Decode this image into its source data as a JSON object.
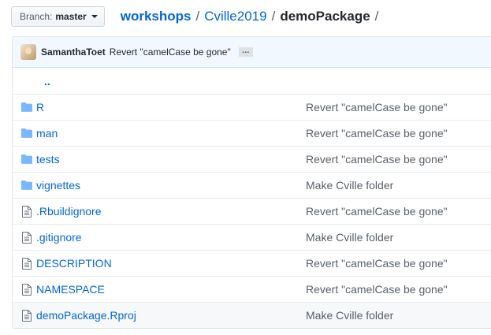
{
  "branch": {
    "prefix": "Branch:",
    "name": "master"
  },
  "breadcrumb": {
    "repo": "workshops",
    "folder": "Cville2019",
    "current": "demoPackage",
    "separator": "/"
  },
  "commit": {
    "author": "SamanthaToet",
    "message": "Revert \"camelCase be gone\"",
    "ellipsis": "…"
  },
  "updir": "..",
  "files": [
    {
      "name": "R",
      "type": "folder",
      "message": "Revert \"camelCase be gone\""
    },
    {
      "name": "man",
      "type": "folder",
      "message": "Revert \"camelCase be gone\""
    },
    {
      "name": "tests",
      "type": "folder",
      "message": "Revert \"camelCase be gone\""
    },
    {
      "name": "vignettes",
      "type": "folder",
      "message": "Make Cville folder"
    },
    {
      "name": ".Rbuildignore",
      "type": "file",
      "message": "Revert \"camelCase be gone\""
    },
    {
      "name": ".gitignore",
      "type": "file",
      "message": "Make Cville folder"
    },
    {
      "name": "DESCRIPTION",
      "type": "file",
      "message": "Revert \"camelCase be gone\""
    },
    {
      "name": "NAMESPACE",
      "type": "file",
      "message": "Revert \"camelCase be gone\""
    },
    {
      "name": "demoPackage.Rproj",
      "type": "file",
      "message": "Make Cville folder"
    }
  ],
  "colors": {
    "link": "#0366d6",
    "folder_icon": "#79b8ff",
    "file_icon": "#6a737d",
    "commit_bar_bg": "#f1f8ff"
  }
}
